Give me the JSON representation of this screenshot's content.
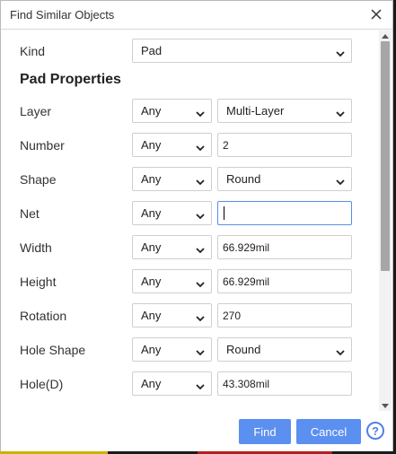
{
  "window": {
    "title": "Find Similar Objects"
  },
  "kind": {
    "label": "Kind",
    "value": "Pad"
  },
  "section": {
    "title": "Pad Properties"
  },
  "rows": [
    {
      "label": "Layer",
      "match": "Any",
      "value": "Multi-Layer",
      "value_type": "select"
    },
    {
      "label": "Number",
      "match": "Any",
      "value": "2",
      "value_type": "input"
    },
    {
      "label": "Shape",
      "match": "Any",
      "value": "Round",
      "value_type": "select"
    },
    {
      "label": "Net",
      "match": "Any",
      "value": "",
      "value_type": "input-focused"
    },
    {
      "label": "Width",
      "match": "Any",
      "value": "66.929mil",
      "value_type": "input"
    },
    {
      "label": "Height",
      "match": "Any",
      "value": "66.929mil",
      "value_type": "input"
    },
    {
      "label": "Rotation",
      "match": "Any",
      "value": "270",
      "value_type": "input"
    },
    {
      "label": "Hole Shape",
      "match": "Any",
      "value": "Round",
      "value_type": "select"
    },
    {
      "label": "Hole(D)",
      "match": "Any",
      "value": "43.308mil",
      "value_type": "input"
    }
  ],
  "buttons": {
    "find": "Find",
    "cancel": "Cancel",
    "help": "?"
  },
  "icons": {
    "close": "close-icon",
    "dropdown": "chevron-down-icon",
    "help": "help-icon"
  },
  "colors": {
    "primary": "#5b8ff0",
    "focus": "#5a8ee6"
  }
}
